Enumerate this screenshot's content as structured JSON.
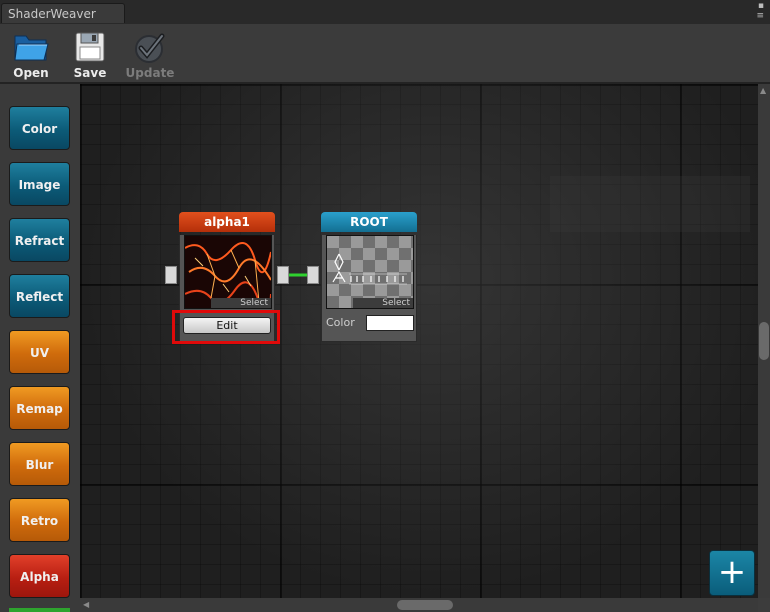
{
  "window": {
    "tab_title": "ShaderWeaver"
  },
  "toolbar": {
    "open_label": "Open",
    "save_label": "Save",
    "update_label": "Update"
  },
  "sidebar": {
    "items": [
      {
        "label": "Color",
        "style": "blue"
      },
      {
        "label": "Image",
        "style": "blue"
      },
      {
        "label": "Refract",
        "style": "blue"
      },
      {
        "label": "Reflect",
        "style": "blue"
      },
      {
        "label": "UV",
        "style": "orange"
      },
      {
        "label": "Remap",
        "style": "orange"
      },
      {
        "label": "Blur",
        "style": "orange"
      },
      {
        "label": "Retro",
        "style": "orange"
      },
      {
        "label": "Alpha",
        "style": "red"
      }
    ]
  },
  "nodes": {
    "alpha": {
      "title": "alpha1",
      "select_label": "Select",
      "edit_label": "Edit",
      "header_color": "#c3390e"
    },
    "root": {
      "title": "ROOT",
      "select_label": "Select",
      "color_label": "Color",
      "color_value": "#ffffff",
      "header_color": "#1d88b0"
    }
  },
  "connection": {
    "color": "#2fd22f"
  },
  "colors": {
    "blue": "#0c5b78",
    "orange": "#cf6b0c",
    "red": "#b81f12",
    "highlight": "#e00a0a"
  }
}
